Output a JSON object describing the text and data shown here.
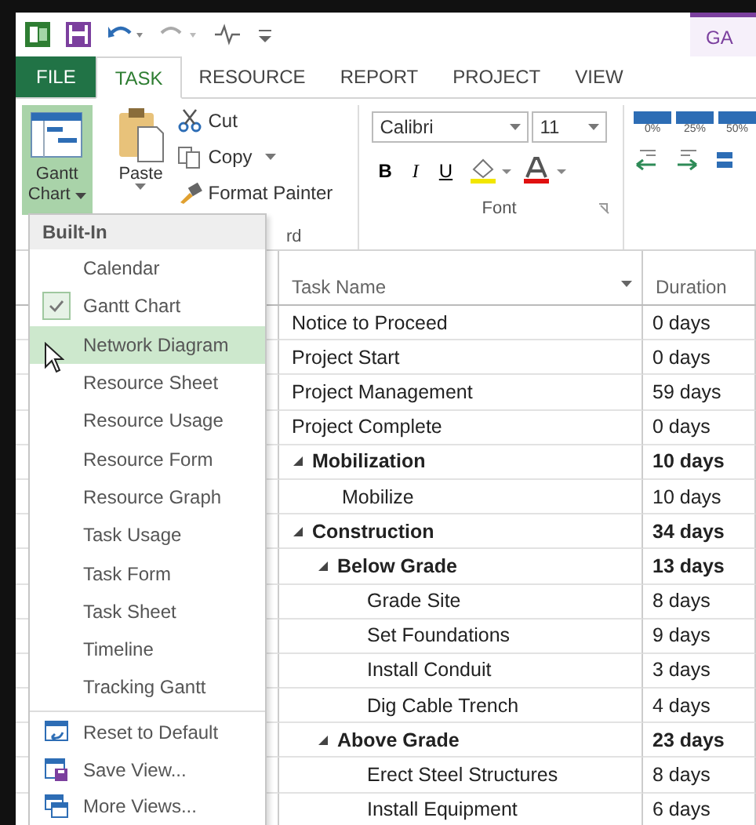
{
  "contextual_tab": "GA",
  "tabs": [
    {
      "label": "FILE",
      "kind": "file",
      "selected": false
    },
    {
      "label": "TASK",
      "kind": "tab",
      "selected": true
    },
    {
      "label": "RESOURCE",
      "kind": "tab",
      "selected": false
    },
    {
      "label": "REPORT",
      "kind": "tab",
      "selected": false
    },
    {
      "label": "PROJECT",
      "kind": "tab",
      "selected": false
    },
    {
      "label": "VIEW",
      "kind": "tab",
      "selected": false
    }
  ],
  "ribbon": {
    "view_button": {
      "label": "Gantt Chart",
      "pressed": true
    },
    "clipboard": {
      "paste": "Paste",
      "cut": "Cut",
      "copy": "Copy",
      "format_painter": "Format Painter",
      "label": "rd"
    },
    "font": {
      "font_name": "Calibri",
      "font_size": "11",
      "bold": "B",
      "italic": "I",
      "underline": "U",
      "label": "Font"
    },
    "schedule": {
      "percent_labels": [
        "0%",
        "25%",
        "50%"
      ]
    }
  },
  "menu": {
    "header": "Built-In",
    "views": [
      {
        "label": "Calendar",
        "checked": false,
        "selected": false
      },
      {
        "label": "Gantt Chart",
        "checked": true,
        "selected": false
      },
      {
        "label": "Network Diagram",
        "checked": false,
        "selected": true
      },
      {
        "label": "Resource Sheet",
        "checked": false,
        "selected": false
      },
      {
        "label": "Resource Usage",
        "checked": false,
        "selected": false
      },
      {
        "label": "Resource Form",
        "checked": false,
        "selected": false
      },
      {
        "label": "Resource Graph",
        "checked": false,
        "selected": false
      },
      {
        "label": "Task Usage",
        "checked": false,
        "selected": false
      },
      {
        "label": "Task Form",
        "checked": false,
        "selected": false
      },
      {
        "label": "Task Sheet",
        "checked": false,
        "selected": false
      },
      {
        "label": "Timeline",
        "checked": false,
        "selected": false
      },
      {
        "label": "Tracking Gantt",
        "checked": false,
        "selected": false
      }
    ],
    "commands": [
      {
        "label": "Reset to Default",
        "kind": "reset"
      },
      {
        "label": "Save View...",
        "kind": "save"
      },
      {
        "label": "More Views...",
        "kind": "more"
      }
    ]
  },
  "sheet": {
    "columns": [
      "Task Name",
      "Duration"
    ],
    "rows": [
      {
        "name": "Notice to Proceed",
        "duration": "0 days",
        "summary": false
      },
      {
        "name": "Project Start",
        "duration": "0 days",
        "summary": false
      },
      {
        "name": "Project Management",
        "duration": "59 days",
        "summary": false
      },
      {
        "name": "Project Complete",
        "duration": "0 days",
        "summary": false
      },
      {
        "name": "Mobilization",
        "duration": "10 days",
        "summary": true,
        "expanded": true,
        "children": [
          {
            "name": "Mobilize",
            "duration": "10 days",
            "summary": false
          }
        ]
      },
      {
        "name": "Construction",
        "duration": "34 days",
        "summary": true,
        "expanded": true,
        "children": [
          {
            "name": "Below Grade",
            "duration": "13 days",
            "summary": true,
            "expanded": true,
            "children": [
              {
                "name": "Grade Site",
                "duration": "8 days",
                "summary": false
              },
              {
                "name": "Set Foundations",
                "duration": "9 days",
                "summary": false
              },
              {
                "name": "Install Conduit",
                "duration": "3 days",
                "summary": false
              },
              {
                "name": "Dig Cable Trench",
                "duration": "4 days",
                "summary": false
              }
            ]
          },
          {
            "name": "Above Grade",
            "duration": "23 days",
            "summary": true,
            "expanded": true,
            "children": [
              {
                "name": "Erect Steel Structures",
                "duration": "8 days",
                "summary": false
              },
              {
                "name": "Install Equipment",
                "duration": "6 days",
                "summary": false
              }
            ]
          }
        ]
      }
    ]
  }
}
